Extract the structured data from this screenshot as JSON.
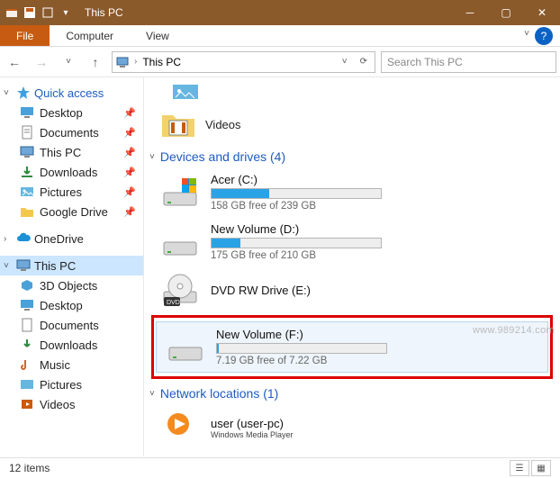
{
  "window": {
    "title": "This PC"
  },
  "ribbon": {
    "file": "File",
    "tabs": [
      "Computer",
      "View"
    ]
  },
  "address": {
    "location": "This PC"
  },
  "search": {
    "placeholder": "Search This PC"
  },
  "sidebar": {
    "quick": {
      "label": "Quick access",
      "items": [
        {
          "label": "Desktop",
          "pin": true
        },
        {
          "label": "Documents",
          "pin": true
        },
        {
          "label": "This PC",
          "pin": true
        },
        {
          "label": "Downloads",
          "pin": true
        },
        {
          "label": "Pictures",
          "pin": true
        },
        {
          "label": "Google Drive",
          "pin": true
        }
      ]
    },
    "onedrive": {
      "label": "OneDrive"
    },
    "thispc": {
      "label": "This PC",
      "items": [
        {
          "label": "3D Objects"
        },
        {
          "label": "Desktop"
        },
        {
          "label": "Documents"
        },
        {
          "label": "Downloads"
        },
        {
          "label": "Music"
        },
        {
          "label": "Pictures"
        },
        {
          "label": "Videos"
        }
      ]
    }
  },
  "content": {
    "folders": [
      {
        "label": "Videos"
      }
    ],
    "devices": {
      "header": "Devices and drives (4)",
      "drives": [
        {
          "name": "Acer (C:)",
          "free": "158 GB free of 239 GB",
          "fill": 34
        },
        {
          "name": "New Volume (D:)",
          "free": "175 GB free of 210 GB",
          "fill": 17
        },
        {
          "name": "DVD RW Drive (E:)",
          "dvd": true
        },
        {
          "name": "New Volume (F:)",
          "free": "7.19 GB free of 7.22 GB",
          "fill": 1,
          "highlight": true
        }
      ]
    },
    "network": {
      "header": "Network locations (1)",
      "items": [
        {
          "label": "user (user-pc)",
          "sub": "Windows Media Player"
        }
      ]
    }
  },
  "status": {
    "text": "12 items"
  },
  "watermark": "www.989214.com"
}
